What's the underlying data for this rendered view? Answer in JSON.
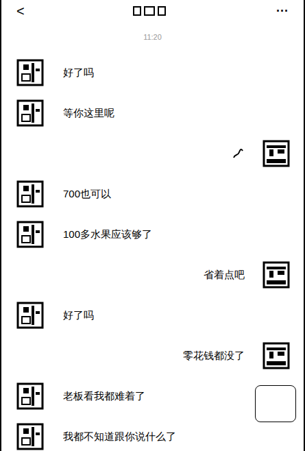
{
  "header": {
    "back": "<",
    "more": "···"
  },
  "timestamp": "11:20",
  "messages": [
    {
      "side": "left",
      "kind": "text",
      "text": "好了吗"
    },
    {
      "side": "left",
      "kind": "text",
      "text": "等你这里呢"
    },
    {
      "side": "right",
      "kind": "sticker"
    },
    {
      "side": "left",
      "kind": "text",
      "text": "700也可以"
    },
    {
      "side": "left",
      "kind": "text",
      "text": "100多水果应该够了"
    },
    {
      "side": "right",
      "kind": "text",
      "text": "省着点吧"
    },
    {
      "side": "left",
      "kind": "text",
      "text": "好了吗"
    },
    {
      "side": "right",
      "kind": "text",
      "text": "零花钱都没了"
    },
    {
      "side": "left",
      "kind": "text",
      "text": "老板看我都难着了"
    },
    {
      "side": "left",
      "kind": "text",
      "text": "我都不知道跟你说什么了"
    }
  ]
}
